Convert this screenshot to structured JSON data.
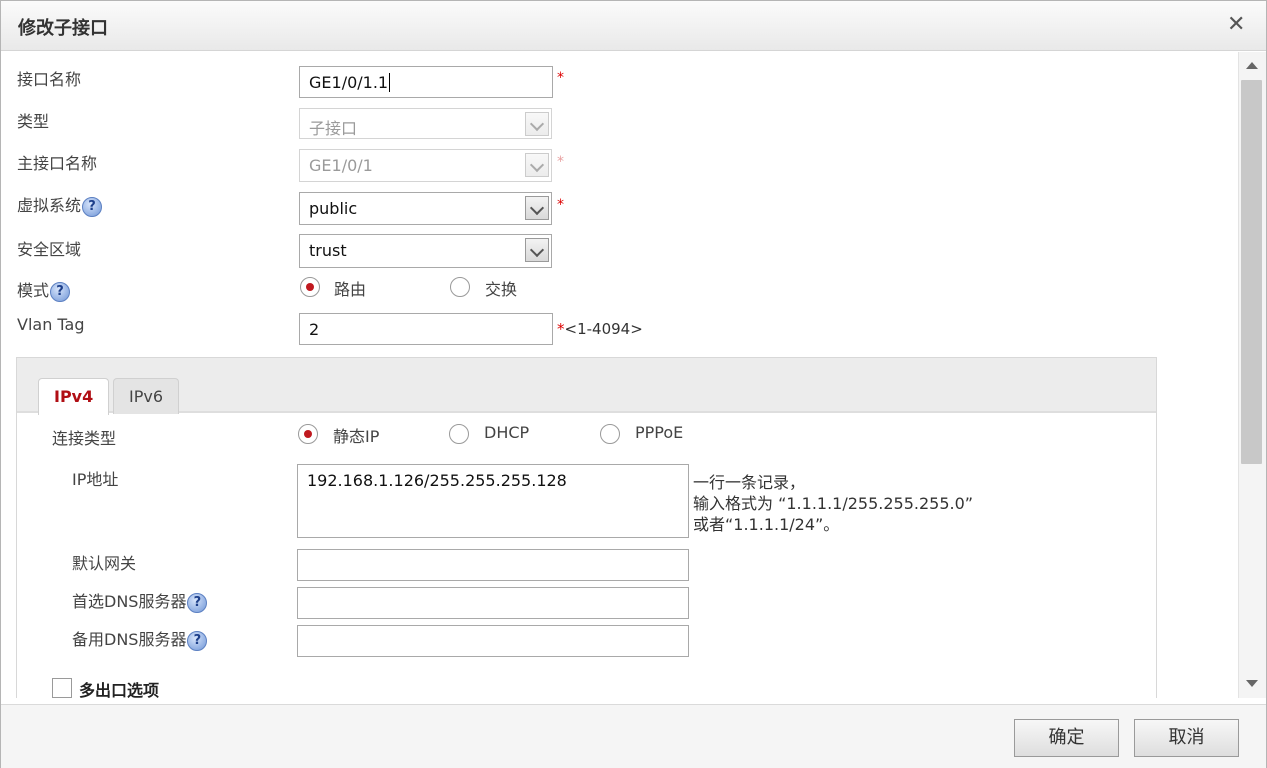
{
  "dialog": {
    "title": "修改子接口"
  },
  "form": {
    "interface_name": {
      "label": "接口名称",
      "value": "GE1/0/1.1",
      "required": "*"
    },
    "type": {
      "label": "类型",
      "value": "子接口"
    },
    "parent_interface": {
      "label": "主接口名称",
      "value": "GE1/0/1",
      "required": "*"
    },
    "vsys": {
      "label": "虚拟系统",
      "value": "public",
      "required": "*"
    },
    "zone": {
      "label": "安全区域",
      "value": "trust"
    },
    "mode": {
      "label": "模式",
      "options": [
        "路由",
        "交换"
      ],
      "selected": "路由"
    },
    "vlan_tag": {
      "label": "Vlan Tag",
      "value": "2",
      "hint": "*<1-4094>"
    }
  },
  "tabs": [
    "IPv4",
    "IPv6"
  ],
  "ipv4": {
    "conn_type": {
      "label": "连接类型",
      "options": [
        "静态IP",
        "DHCP",
        "PPPoE"
      ],
      "selected": "静态IP"
    },
    "ip_address": {
      "label": "IP地址",
      "value": "192.168.1.126/255.255.255.128",
      "hint_lines": [
        "一行一条记录，",
        "输入格式为 “1.1.1.1/255.255.255.0”",
        "或者“1.1.1.1/24”。"
      ]
    },
    "gateway": {
      "label": "默认网关",
      "value": ""
    },
    "dns1": {
      "label": "首选DNS服务器",
      "value": ""
    },
    "dns2": {
      "label": "备用DNS服务器",
      "value": ""
    },
    "multi_exit": {
      "label": "多出口选项"
    }
  },
  "help_glyph": "?",
  "buttons": {
    "ok": "确定",
    "cancel": "取消"
  },
  "close_glyph": "✕",
  "colors": {
    "accent": "#c0191f",
    "tab_active": "#b00e14"
  }
}
